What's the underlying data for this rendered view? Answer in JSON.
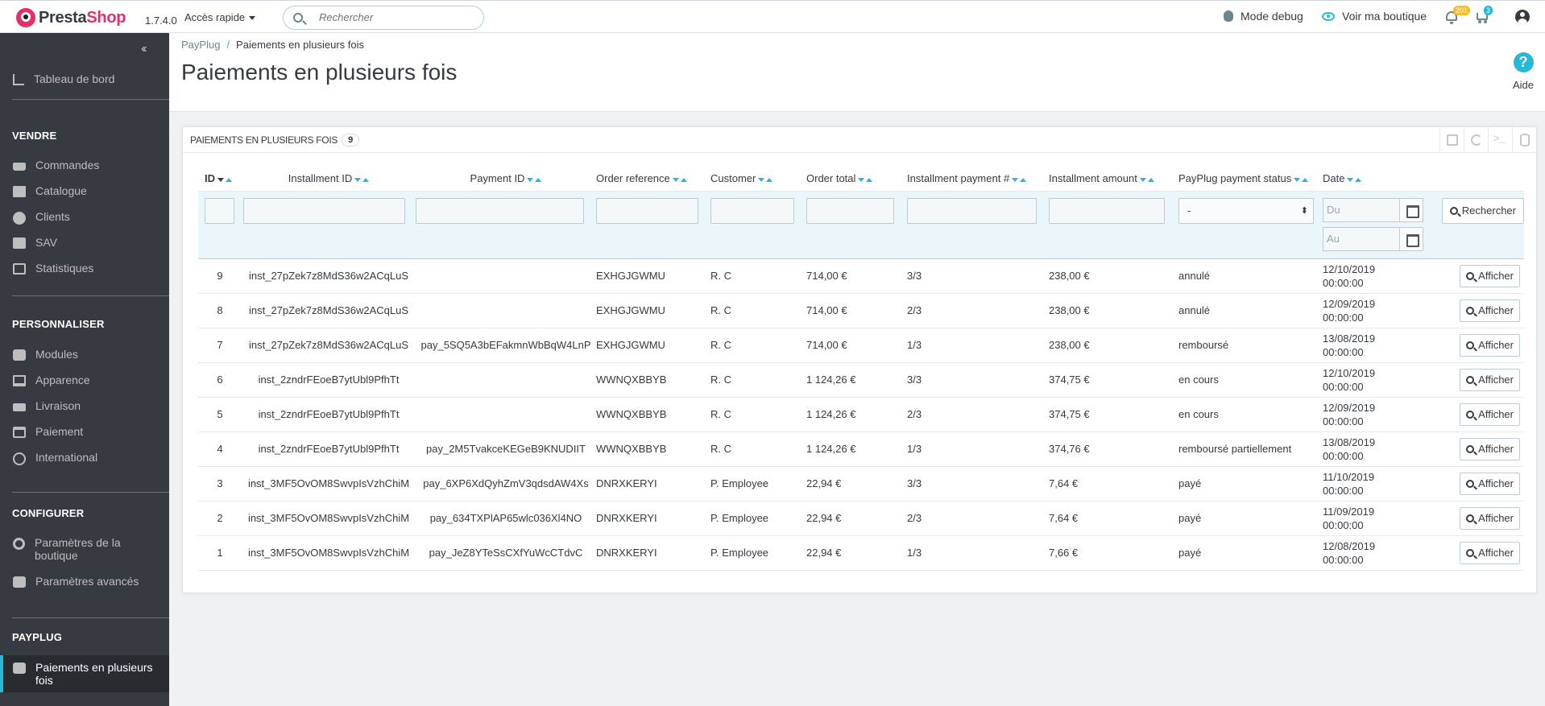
{
  "header": {
    "logo_presta": "Presta",
    "logo_shop": "Shop",
    "version": "1.7.4.0",
    "quick_access": "Accès rapide",
    "search_placeholder": "Rechercher",
    "debug_mode": "Mode debug",
    "view_shop": "Voir ma boutique",
    "notifications_count": "201",
    "cart_count": "3"
  },
  "sidebar": {
    "dashboard": "Tableau de bord",
    "sections": [
      {
        "title": "VENDRE",
        "items": [
          "Commandes",
          "Catalogue",
          "Clients",
          "SAV",
          "Statistiques"
        ]
      },
      {
        "title": "PERSONNALISER",
        "items": [
          "Modules",
          "Apparence",
          "Livraison",
          "Paiement",
          "International"
        ]
      },
      {
        "title": "CONFIGURER",
        "items": [
          "Paramètres de la boutique",
          "Paramètres avancés"
        ]
      },
      {
        "title": "PAYPLUG",
        "items": [
          "Paiements en plusieurs fois"
        ]
      }
    ]
  },
  "page": {
    "breadcrumb": [
      "PayPlug",
      "Paiements en plusieurs fois"
    ],
    "title": "Paiements en plusieurs fois",
    "help": "Aide"
  },
  "panel": {
    "title": "Paiements en plusieurs fois",
    "count": "9",
    "columns": [
      "ID",
      "Installment ID",
      "Payment ID",
      "Order reference",
      "Customer",
      "Order total",
      "Installment payment #",
      "Installment amount",
      "PayPlug payment status",
      "Date"
    ],
    "status_filter_value": "-",
    "date_from_placeholder": "Du",
    "date_to_placeholder": "Au",
    "search_button": "Rechercher",
    "view_button": "Afficher",
    "rows": [
      {
        "id": "9",
        "installment_id": "inst_27pZek7z8MdS36w2ACqLuS",
        "payment_id": "",
        "order_ref": "EXHGJGWMU",
        "customer": "R. C",
        "order_total": "714,00 €",
        "installment_no": "3/3",
        "amount": "238,00 €",
        "status": "annulé",
        "date": "12/10/2019",
        "time": "00:00:00"
      },
      {
        "id": "8",
        "installment_id": "inst_27pZek7z8MdS36w2ACqLuS",
        "payment_id": "",
        "order_ref": "EXHGJGWMU",
        "customer": "R. C",
        "order_total": "714,00 €",
        "installment_no": "2/3",
        "amount": "238,00 €",
        "status": "annulé",
        "date": "12/09/2019",
        "time": "00:00:00"
      },
      {
        "id": "7",
        "installment_id": "inst_27pZek7z8MdS36w2ACqLuS",
        "payment_id": "pay_5SQ5A3bEFakmnWbBqW4LnP",
        "order_ref": "EXHGJGWMU",
        "customer": "R. C",
        "order_total": "714,00 €",
        "installment_no": "1/3",
        "amount": "238,00 €",
        "status": "remboursé",
        "date": "13/08/2019",
        "time": "00:00:00"
      },
      {
        "id": "6",
        "installment_id": "inst_2zndrFEoeB7ytUbl9PfhTt",
        "payment_id": "",
        "order_ref": "WWNQXBBYB",
        "customer": "R. C",
        "order_total": "1 124,26 €",
        "installment_no": "3/3",
        "amount": "374,75 €",
        "status": "en cours",
        "date": "12/10/2019",
        "time": "00:00:00"
      },
      {
        "id": "5",
        "installment_id": "inst_2zndrFEoeB7ytUbl9PfhTt",
        "payment_id": "",
        "order_ref": "WWNQXBBYB",
        "customer": "R. C",
        "order_total": "1 124,26 €",
        "installment_no": "2/3",
        "amount": "374,75 €",
        "status": "en cours",
        "date": "12/09/2019",
        "time": "00:00:00"
      },
      {
        "id": "4",
        "installment_id": "inst_2zndrFEoeB7ytUbl9PfhTt",
        "payment_id": "pay_2M5TvakceKEGeB9KNUDIIT",
        "order_ref": "WWNQXBBYB",
        "customer": "R. C",
        "order_total": "1 124,26 €",
        "installment_no": "1/3",
        "amount": "374,76 €",
        "status": "remboursé partiellement",
        "date": "13/08/2019",
        "time": "00:00:00"
      },
      {
        "id": "3",
        "installment_id": "inst_3MF5OvOM8SwvpIsVzhChiM",
        "payment_id": "pay_6XP6XdQyhZmV3qdsdAW4Xs",
        "order_ref": "DNRXKERYI",
        "customer": "P. Employee",
        "order_total": "22,94 €",
        "installment_no": "3/3",
        "amount": "7,64 €",
        "status": "payé",
        "date": "11/10/2019",
        "time": "00:00:00"
      },
      {
        "id": "2",
        "installment_id": "inst_3MF5OvOM8SwvpIsVzhChiM",
        "payment_id": "pay_634TXPlAP65wlc036Xl4NO",
        "order_ref": "DNRXKERYI",
        "customer": "P. Employee",
        "order_total": "22,94 €",
        "installment_no": "2/3",
        "amount": "7,64 €",
        "status": "payé",
        "date": "11/09/2019",
        "time": "00:00:00"
      },
      {
        "id": "1",
        "installment_id": "inst_3MF5OvOM8SwvpIsVzhChiM",
        "payment_id": "pay_JeZ8YTeSsCXfYuWcCTdvC",
        "order_ref": "DNRXKERYI",
        "customer": "P. Employee",
        "order_total": "22,94 €",
        "installment_no": "1/3",
        "amount": "7,66 €",
        "status": "payé",
        "date": "12/08/2019",
        "time": "00:00:00"
      }
    ]
  }
}
